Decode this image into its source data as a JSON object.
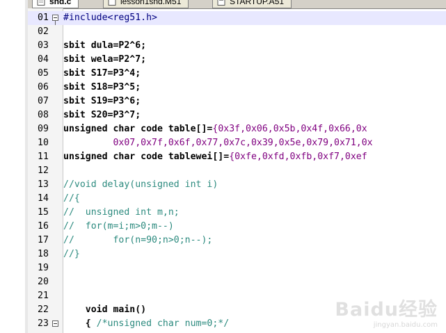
{
  "tabs": [
    {
      "label": "snd.c",
      "active": true
    },
    {
      "label": "lesson1snd.M51",
      "active": false
    },
    {
      "label": "STARTUP.A51",
      "active": false
    }
  ],
  "lines": [
    {
      "num": "01",
      "text": "#include<reg51.h>",
      "style": "pp",
      "current": true,
      "fold": true
    },
    {
      "num": "02",
      "text": "",
      "style": "plain"
    },
    {
      "num": "03",
      "text": "sbit dula=P2^6;",
      "style": "bold"
    },
    {
      "num": "04",
      "text": "sbit wela=P2^7;",
      "style": "bold"
    },
    {
      "num": "05",
      "text": "sbit S17=P3^4;",
      "style": "bold"
    },
    {
      "num": "06",
      "text": "sbit S18=P3^5;",
      "style": "bold"
    },
    {
      "num": "07",
      "text": "sbit S19=P3^6;",
      "style": "bold"
    },
    {
      "num": "08",
      "text": "sbit S20=P3^7;",
      "style": "bold"
    },
    {
      "num": "09",
      "text": "unsigned char code table[]={0x3f,0x06,0x5b,0x4f,0x66,0x",
      "style": "table"
    },
    {
      "num": "10",
      "text": "         0x07,0x7f,0x6f,0x77,0x7c,0x39,0x5e,0x79,0x71,0x",
      "style": "num"
    },
    {
      "num": "11",
      "text": "unsigned char code tablewei[]={0xfe,0xfd,0xfb,0xf7,0xef",
      "style": "table"
    },
    {
      "num": "12",
      "text": "",
      "style": "plain"
    },
    {
      "num": "13",
      "text": "//void delay(unsigned int i)",
      "style": "cm"
    },
    {
      "num": "14",
      "text": "//{",
      "style": "cm"
    },
    {
      "num": "15",
      "text": "//  unsigned int m,n;",
      "style": "cm"
    },
    {
      "num": "16",
      "text": "//  for(m=i;m>0;m--)",
      "style": "cm"
    },
    {
      "num": "17",
      "text": "//       for(n=90;n>0;n--);",
      "style": "cm"
    },
    {
      "num": "18",
      "text": "//}",
      "style": "cm"
    },
    {
      "num": "19",
      "text": "",
      "style": "plain"
    },
    {
      "num": "20",
      "text": "",
      "style": "plain"
    },
    {
      "num": "21",
      "text": "",
      "style": "plain"
    },
    {
      "num": "22",
      "text": "    void main()",
      "style": "bold"
    },
    {
      "num": "23",
      "text": "    { /*unsigned char num=0;*/",
      "style": "brace",
      "fold": true
    }
  ],
  "watermark": {
    "logo": "Baidu经验",
    "url": "jingyan.baidu.com"
  }
}
